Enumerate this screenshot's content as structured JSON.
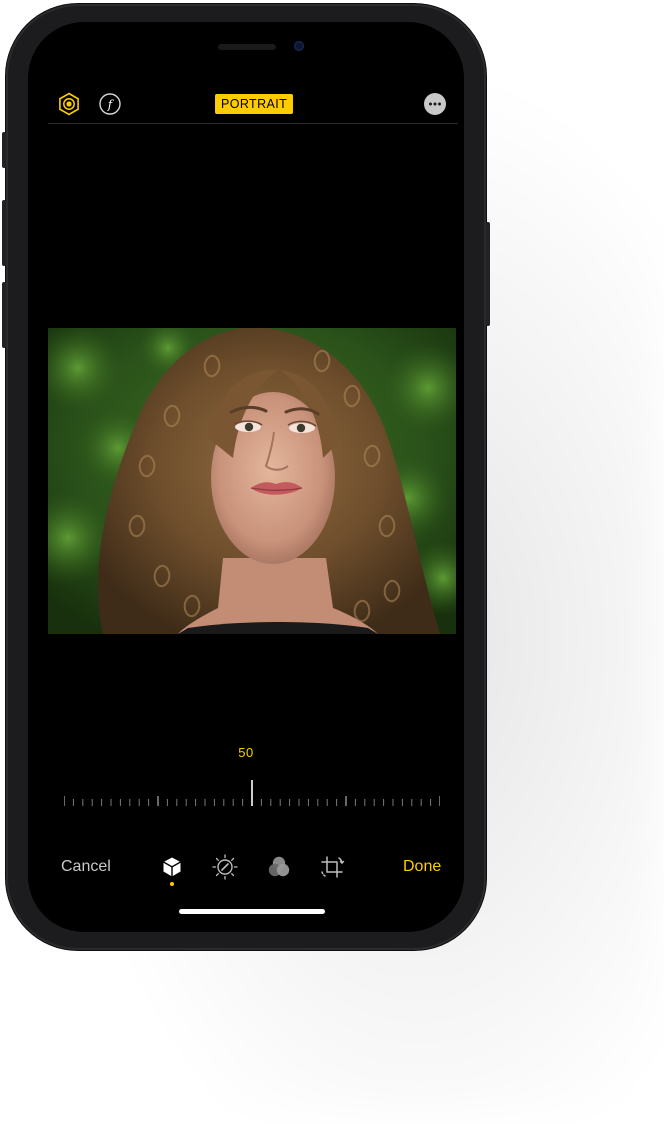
{
  "header": {
    "mode_badge": "PORTRAIT"
  },
  "slider": {
    "value": "50",
    "position": 0.5
  },
  "footer": {
    "cancel_label": "Cancel",
    "done_label": "Done"
  },
  "icons": {
    "lighting": "portrait-lighting-icon",
    "aperture": "aperture-f-icon",
    "more": "more-options-icon",
    "portrait_tool": "portrait-cube-icon",
    "adjust_tool": "adjust-dial-icon",
    "filters_tool": "filters-icon",
    "crop_tool": "crop-rotate-icon"
  },
  "colors": {
    "accent": "#ffcc00",
    "background": "#000000",
    "secondary_text": "#c8c8c8"
  }
}
